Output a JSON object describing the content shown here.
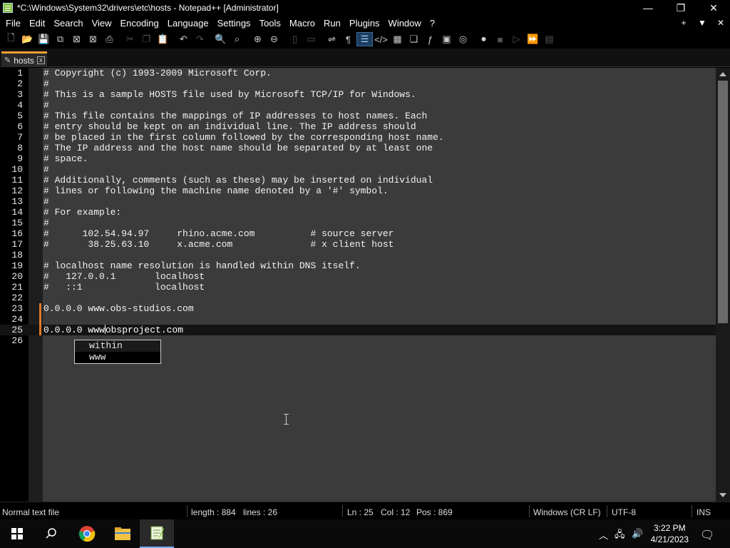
{
  "window": {
    "title": "*C:\\Windows\\System32\\drivers\\etc\\hosts - Notepad++ [Administrator]",
    "minimize": "—",
    "maximize": "❐",
    "close": "✕"
  },
  "menu": {
    "items": [
      "File",
      "Edit",
      "Search",
      "View",
      "Encoding",
      "Language",
      "Settings",
      "Tools",
      "Macro",
      "Run",
      "Plugins",
      "Window",
      "?"
    ],
    "right": [
      "+",
      "▼",
      "✕"
    ]
  },
  "toolbar": {
    "icons": [
      "new-file-icon",
      "open-file-icon",
      "save-icon",
      "save-all-icon",
      "close-icon",
      "close-all-icon",
      "print-icon",
      "cut-icon",
      "copy-icon",
      "paste-icon",
      "undo-icon",
      "redo-icon",
      "find-icon",
      "replace-icon",
      "zoom-in-icon",
      "zoom-out-icon",
      "sync-vertical-icon",
      "sync-horizontal-icon",
      "word-wrap-icon",
      "show-all-chars-icon",
      "indent-guide-icon",
      "xml-tag-icon",
      "doc-map-icon",
      "doc-list-icon",
      "function-list-icon",
      "folder-workspace-icon",
      "monitoring-icon",
      "record-macro-icon",
      "stop-record-icon",
      "play-macro-icon",
      "run-macro-multiple-icon",
      "save-macro-icon"
    ]
  },
  "tab": {
    "label": "hosts",
    "close": "x"
  },
  "editor": {
    "lines": [
      {
        "n": "1",
        "text": "# Copyright (c) 1993-2009 Microsoft Corp."
      },
      {
        "n": "2",
        "text": "#"
      },
      {
        "n": "3",
        "text": "# This is a sample HOSTS file used by Microsoft TCP/IP for Windows."
      },
      {
        "n": "4",
        "text": "#"
      },
      {
        "n": "5",
        "text": "# This file contains the mappings of IP addresses to host names. Each"
      },
      {
        "n": "6",
        "text": "# entry should be kept on an individual line. The IP address should"
      },
      {
        "n": "7",
        "text": "# be placed in the first column followed by the corresponding host name."
      },
      {
        "n": "8",
        "text": "# The IP address and the host name should be separated by at least one"
      },
      {
        "n": "9",
        "text": "# space."
      },
      {
        "n": "10",
        "text": "#"
      },
      {
        "n": "11",
        "text": "# Additionally, comments (such as these) may be inserted on individual"
      },
      {
        "n": "12",
        "text": "# lines or following the machine name denoted by a '#' symbol."
      },
      {
        "n": "13",
        "text": "#"
      },
      {
        "n": "14",
        "text": "# For example:"
      },
      {
        "n": "15",
        "text": "#"
      },
      {
        "n": "16",
        "text": "#      102.54.94.97     rhino.acme.com          # source server"
      },
      {
        "n": "17",
        "text": "#       38.25.63.10     x.acme.com              # x client host"
      },
      {
        "n": "18",
        "text": ""
      },
      {
        "n": "19",
        "text": "# localhost name resolution is handled within DNS itself."
      },
      {
        "n": "20",
        "text": "#   127.0.0.1       localhost"
      },
      {
        "n": "21",
        "text": "#   ::1             localhost"
      },
      {
        "n": "22",
        "text": ""
      },
      {
        "n": "23",
        "text": "0.0.0.0 www.obs-studios.com"
      },
      {
        "n": "24",
        "text": ""
      },
      {
        "n": "25",
        "text_before_caret": "0.0.0.0 www",
        "text_after_caret": "obsproject.com"
      },
      {
        "n": "26",
        "text": ""
      }
    ],
    "current_line": "25"
  },
  "autocomplete": {
    "items": [
      "within",
      "www"
    ],
    "selected": "www"
  },
  "status": {
    "file_type": "Normal text file",
    "length": "length : 884",
    "lines": "lines : 26",
    "ln": "Ln : 25",
    "col": "Col : 12",
    "pos": "Pos : 869",
    "eol": "Windows (CR LF)",
    "encoding": "UTF-8",
    "mode": "INS"
  },
  "taskbar": {
    "time": "3:22 PM",
    "date": "4/21/2023",
    "apps": [
      "start-icon",
      "search-icon",
      "chrome-icon",
      "file-explorer-icon",
      "notepad-plus-plus-icon"
    ]
  }
}
